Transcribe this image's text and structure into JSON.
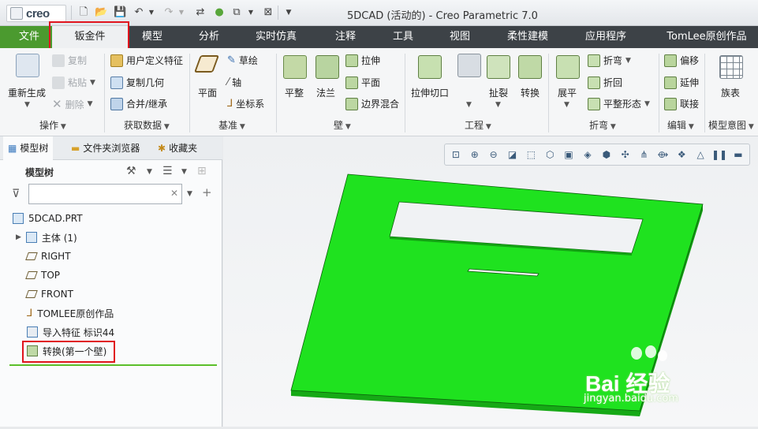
{
  "app": {
    "logo_text": "creo",
    "window_title": "5DCAD (活动的) - Creo Parametric 7.0"
  },
  "menu_tabs": [
    {
      "label": "文件"
    },
    {
      "label": "钣金件"
    },
    {
      "label": "模型"
    },
    {
      "label": "分析"
    },
    {
      "label": "实时仿真"
    },
    {
      "label": "注释"
    },
    {
      "label": "工具"
    },
    {
      "label": "视图"
    },
    {
      "label": "柔性建模"
    },
    {
      "label": "应用程序"
    },
    {
      "label": "TomLee原创作品"
    }
  ],
  "ribbon": {
    "operations": {
      "regenerate": "重新生成",
      "copy": "复制",
      "paste": "粘贴",
      "delete": "删除",
      "group": "操作"
    },
    "get_data": {
      "udf": "用户定义特征",
      "copy_geom": "复制几何",
      "merge": "合并/继承",
      "group": "获取数据"
    },
    "datum": {
      "plane": "平面",
      "sketch": "草绘",
      "axis": "轴",
      "csys": "坐标系",
      "group": "基准"
    },
    "wall": {
      "planar": "平整",
      "flange": "法兰",
      "extrude": "拉伸",
      "flat": "平面",
      "blend": "边界混合",
      "group": "壁"
    },
    "engineering": {
      "extrude_cut": "拉伸切口",
      "rip": "扯裂",
      "convert": "转换",
      "group": "工程"
    },
    "bend": {
      "unbend": "展平",
      "bend": "折弯",
      "bend_back": "折回",
      "flat_form": "平整形态",
      "group": "折弯"
    },
    "edit": {
      "offset": "偏移",
      "extend": "延伸",
      "join": "联接",
      "group": "编辑"
    },
    "model_intent": {
      "family_table": "族表",
      "group": "模型意图"
    }
  },
  "left_panel": {
    "tabs": [
      {
        "label": "模型树"
      },
      {
        "label": "文件夹浏览器"
      },
      {
        "label": "收藏夹"
      }
    ],
    "tree_title": "模型树",
    "filter_placeholder": "",
    "tree": [
      {
        "label": "5DCAD.PRT",
        "icon": "part-icon"
      },
      {
        "label": "主体 (1)",
        "icon": "body-icon"
      },
      {
        "label": "RIGHT",
        "icon": "datum-plane-icon"
      },
      {
        "label": "TOP",
        "icon": "datum-plane-icon"
      },
      {
        "label": "FRONT",
        "icon": "datum-plane-icon"
      },
      {
        "label": "TOMLEE原创作品",
        "icon": "csys-icon"
      },
      {
        "label": "导入特征 标识44",
        "icon": "import-feature-icon"
      },
      {
        "label": "转换(第一个壁)",
        "icon": "convert-icon"
      }
    ]
  },
  "colors": {
    "model_fill": "#1fe21f",
    "model_edge": "#0b5f0b",
    "highlight_box": "#e0141e",
    "file_tab": "#4b9a2f"
  },
  "watermark": {
    "text": "Bai 经验",
    "sub": "jingyan.baidu.com"
  }
}
